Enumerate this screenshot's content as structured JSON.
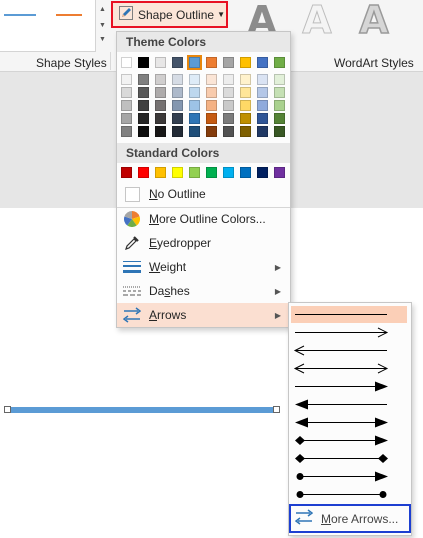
{
  "ribbon": {
    "shape_outline_label": "Shape Outline",
    "shape_styles_label": "Shape Styles",
    "wordart_styles_label": "WordArt Styles",
    "wordart_sample": "A"
  },
  "menu": {
    "theme_colors_header": "Theme Colors",
    "standard_colors_header": "Standard Colors",
    "theme_top_row": [
      "#ffffff",
      "#000000",
      "#e7e6e6",
      "#44546a",
      "#5b9bd5",
      "#ed7d31",
      "#a5a5a5",
      "#ffc000",
      "#4472c4",
      "#70ad47"
    ],
    "theme_shades": [
      [
        "#f2f2f2",
        "#7f7f7f",
        "#d0cece",
        "#d6dce5",
        "#deebf7",
        "#fbe5d6",
        "#ededed",
        "#fff2cc",
        "#dae3f3",
        "#e2f0d9"
      ],
      [
        "#d9d9d9",
        "#595959",
        "#aeabab",
        "#adb9ca",
        "#bdd7ee",
        "#f8cbad",
        "#dbdbdb",
        "#ffe699",
        "#b4c7e7",
        "#c5e0b4"
      ],
      [
        "#bfbfbf",
        "#404040",
        "#757171",
        "#8497b0",
        "#9dc3e6",
        "#f4b183",
        "#c9c9c9",
        "#ffd966",
        "#8faadc",
        "#a9d18e"
      ],
      [
        "#a6a6a6",
        "#262626",
        "#3b3838",
        "#333f50",
        "#2e75b6",
        "#c55a11",
        "#7b7b7b",
        "#bf9000",
        "#2f5597",
        "#548235"
      ],
      [
        "#808080",
        "#0d0d0d",
        "#171616",
        "#222a35",
        "#1f4e79",
        "#843c0c",
        "#525252",
        "#7f6000",
        "#203864",
        "#385723"
      ]
    ],
    "standard_colors": [
      "#c00000",
      "#ff0000",
      "#ffc000",
      "#ffff00",
      "#92d050",
      "#00b050",
      "#00b0f0",
      "#0070c0",
      "#002060",
      "#7030a0"
    ],
    "no_outline_pre": "",
    "no_outline_ul": "N",
    "no_outline_post": "o Outline",
    "more_colors_pre": "",
    "more_colors_ul": "M",
    "more_colors_post": "ore Outline Colors...",
    "eyedropper_pre": "",
    "eyedropper_ul": "E",
    "eyedropper_post": "yedropper",
    "weight_pre": "",
    "weight_ul": "W",
    "weight_post": "eight",
    "dashes_pre": "Da",
    "dashes_ul": "s",
    "dashes_post": "hes",
    "arrows_pre": "",
    "arrows_ul": "A",
    "arrows_post": "rrows"
  },
  "submenu": {
    "more_arrows_pre": "",
    "more_arrows_ul": "M",
    "more_arrows_post": "ore Arrows..."
  },
  "colors": {
    "selected_border": "#e81123",
    "focus_border": "#1d3fd1",
    "hover": "#fbdfd1",
    "line_shape": "#5b9bd5"
  }
}
